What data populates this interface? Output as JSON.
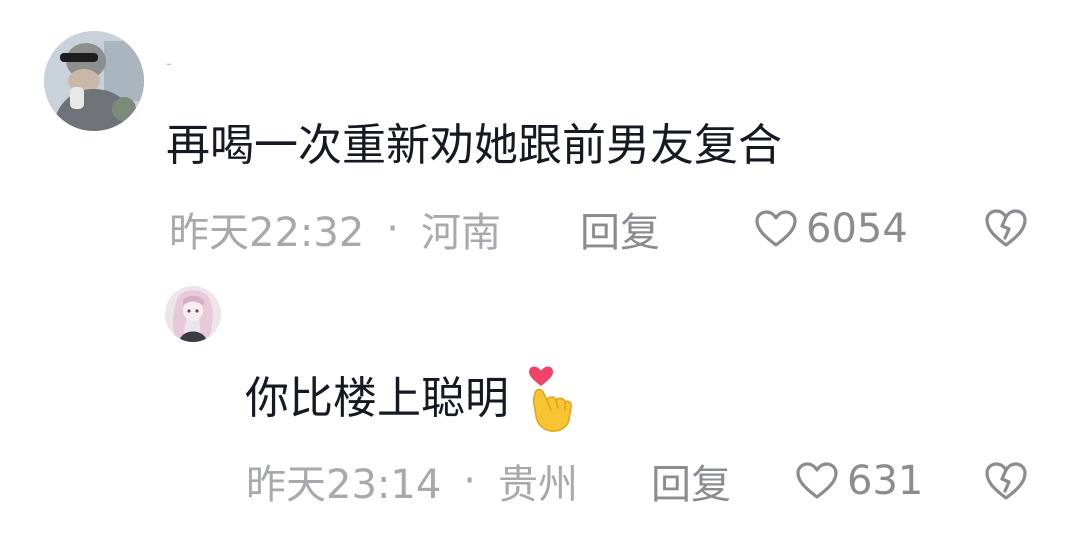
{
  "comments": [
    {
      "username": "-",
      "text": "再喝一次重新劝她跟前男友复合",
      "time": "昨天22:32",
      "location": "河南",
      "reply_label": "回复",
      "likes": "6054"
    },
    {
      "text": "你比楼上聪明",
      "emoji_icon": "finger-heart-emoji",
      "time": "昨天23:14",
      "location": "贵州",
      "reply_label": "回复",
      "likes": "631"
    }
  ],
  "separator": "·",
  "colors": {
    "text": "#161823",
    "meta": "#a8a9ae",
    "action": "#8b8c92",
    "heart_emoji": "#f0436a",
    "hand_emoji": "#f7c531"
  }
}
